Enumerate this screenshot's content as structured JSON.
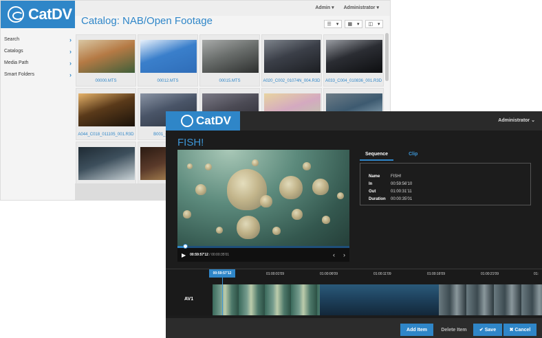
{
  "catalog": {
    "logo_text": "CatDV",
    "title": "Catalog: NAB/Open Footage",
    "user_menu": [
      "Admin",
      "Administrator"
    ],
    "view_buttons": [
      "list-view-icon",
      "grid-view-icon",
      "panel-view-icon"
    ],
    "sidebar": [
      {
        "label": "Search"
      },
      {
        "label": "Catalogs"
      },
      {
        "label": "Media Path"
      },
      {
        "label": "Smart Folders"
      }
    ],
    "tiles": [
      {
        "name": "00000.MTS",
        "colors": [
          "#b57a45",
          "#3f5f3a",
          "#d9c7a3"
        ]
      },
      {
        "name": "00012.MTS",
        "colors": [
          "#3a7fcb",
          "#2f6db8",
          "#e8f1fb"
        ]
      },
      {
        "name": "00015.MTS",
        "colors": [
          "#6a6e6c",
          "#2d2f2e",
          "#a8aaa9"
        ]
      },
      {
        "name": "A020_C002_01074N_004.R3D",
        "colors": [
          "#3b3f48",
          "#1c1e22",
          "#7e848c"
        ]
      },
      {
        "name": "A033_C004_010836_001.R3D",
        "colors": [
          "#2b2d33",
          "#0d0e10",
          "#9a9da3"
        ]
      },
      {
        "name": "A044_C018_011105_001.R3D",
        "colors": [
          "#5a3a1a",
          "#1a120a",
          "#e6b36a"
        ]
      },
      {
        "name": "B001_C010_01",
        "colors": [
          "#4a5568",
          "#2c3440",
          "#8a94a4"
        ]
      },
      {
        "name": "",
        "colors": [
          "#4c4b55",
          "#2a2930",
          "#7b7a86"
        ]
      },
      {
        "name": "",
        "colors": [
          "#d4a9c0",
          "#b8d1a5",
          "#e8d4a0"
        ]
      },
      {
        "name": "",
        "colors": [
          "#3d5a70",
          "#a9c0cc",
          "#6d7c86"
        ]
      },
      {
        "name": "",
        "colors": [
          "#3d4f5c",
          "#c9d2d6",
          "#1e2a33"
        ]
      },
      {
        "name": "",
        "colors": [
          "#5a3a2a",
          "#c8a060",
          "#2a1a12"
        ]
      }
    ]
  },
  "editor": {
    "logo_text": "CatDV",
    "user": "Administrator",
    "title": "FISH!",
    "player": {
      "current_tc": "00:59:57'12",
      "separator": " / ",
      "duration_tc": "00:00:35'01",
      "progress": 0.04
    },
    "tabs": {
      "sequence": "Sequence",
      "clip": "Clip"
    },
    "metadata": [
      {
        "key": "Name",
        "value": "FISH!"
      },
      {
        "key": "In",
        "value": "00:59:56'10"
      },
      {
        "key": "Out",
        "value": "01:00:31'11"
      },
      {
        "key": "Duration",
        "value": "00:00:35'01"
      }
    ],
    "timeline": {
      "current_tc": "00:59:57'12",
      "ticks": [
        "01:00:01'09",
        "01:00:06'09",
        "01:00:11'09",
        "01:00:16'09",
        "01:00:21'09",
        "01:"
      ],
      "track_label": "AV1"
    },
    "footer": {
      "add_item": "Add Item",
      "delete_item": "Delete Item",
      "save": "Save",
      "cancel": "Cancel"
    }
  },
  "colors": {
    "accent": "#2f86c8",
    "dark_bg": "#1c1c1c"
  }
}
